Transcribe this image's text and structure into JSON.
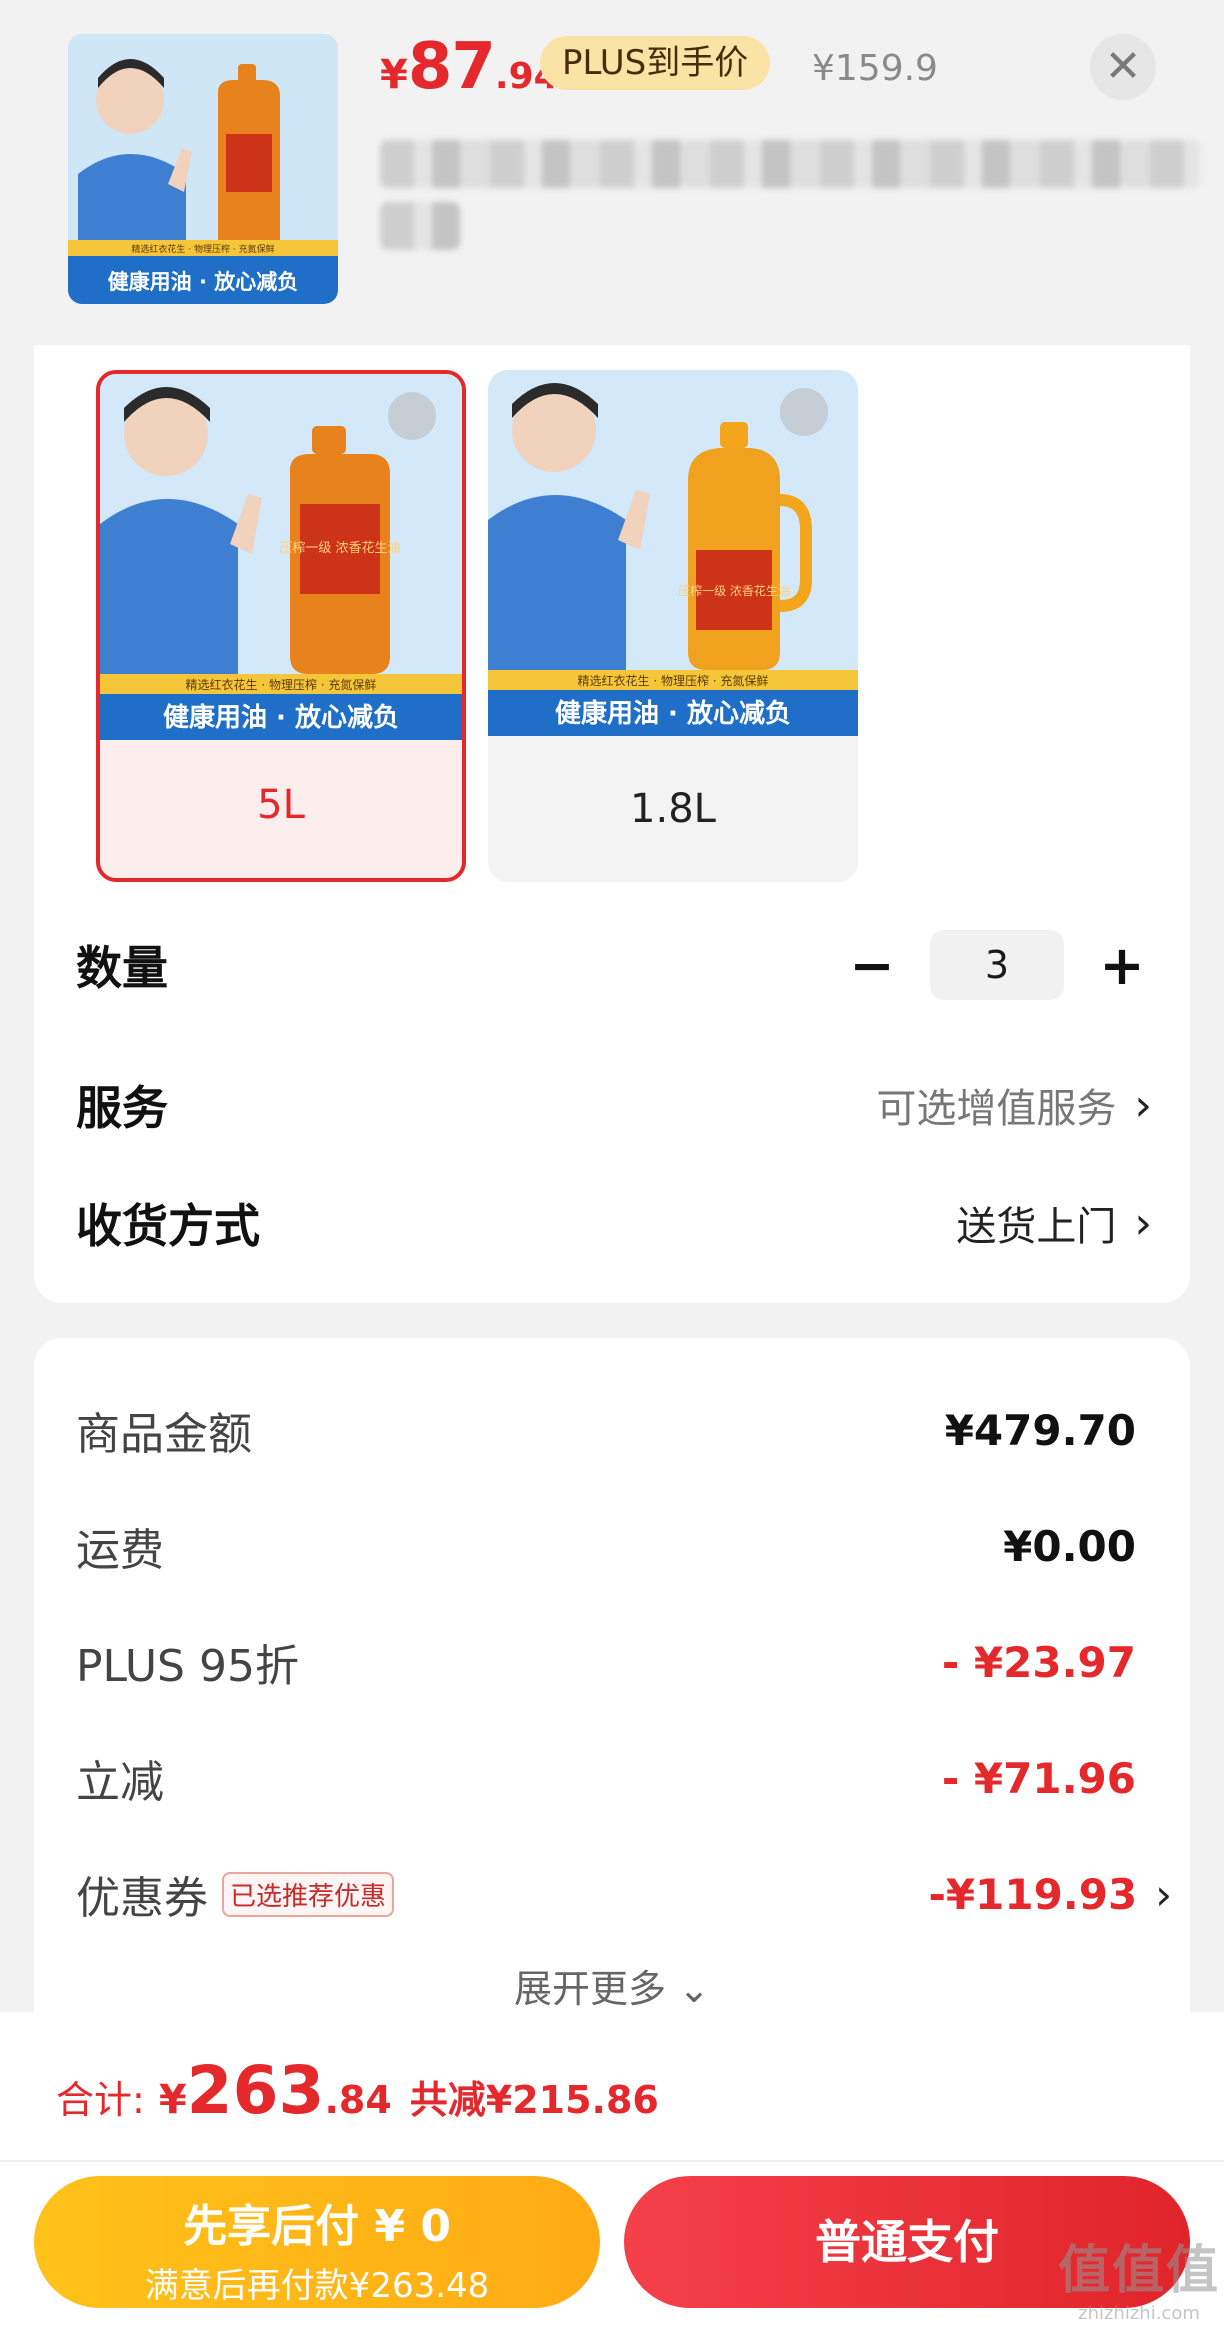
{
  "header": {
    "price": {
      "currency": "¥",
      "integer": "87",
      "decimal": ".94"
    },
    "plus_badge": "PLUS到手价",
    "original_price": "¥159.9",
    "close_icon": "close-icon",
    "thumb_banner": "健康用油 · 放心减负",
    "thumb_sub": "精选红衣花生 · 物理压榨 · 充氮保鲜"
  },
  "variants": [
    {
      "label": "5L",
      "banner": "健康用油 · 放心减负",
      "sub": "精选红衣花生 · 物理压榨 · 充氮保鲜",
      "bottle": "压榨一级 浓香花生油",
      "selected": true
    },
    {
      "label": "1.8L",
      "banner": "健康用油 · 放心减负",
      "sub": "精选红衣花生 · 物理压榨 · 充氮保鲜",
      "bottle": "压榨一级 浓香花生油",
      "selected": false
    }
  ],
  "options": {
    "quantity_label": "数量",
    "quantity_minus": "−",
    "quantity_value": "3",
    "quantity_plus": "+",
    "service_label": "服务",
    "service_value": "可选增值服务",
    "delivery_label": "收货方式",
    "delivery_value": "送货上门",
    "chevron": "›"
  },
  "fees": {
    "goods_label": "商品金额",
    "goods_value": "¥479.70",
    "shipping_label": "运费",
    "shipping_value": "¥0.00",
    "plus_label": "PLUS 95折",
    "plus_value": "- ¥23.97",
    "discount_label": "立减",
    "discount_value": "- ¥71.96",
    "coupon_label": "优惠券",
    "coupon_tag": "已选推荐优惠",
    "coupon_value": "-¥119.93",
    "expand_more": "展开更多 ⌄"
  },
  "total": {
    "label": "合计:",
    "currency": "¥",
    "integer": "263",
    "decimal": ".84",
    "saved": "共减¥215.86"
  },
  "pay": {
    "later_title": "先享后付 ¥ 0",
    "later_sub": "满意后再付款¥263.48",
    "normal": "普通支付"
  },
  "watermark": {
    "main": "值值值",
    "sub": "zhizhizhi.com"
  },
  "colors": {
    "accent_red": "#e4282b",
    "plus_gold": "#fbe3a6",
    "pay_later": "#ffb514"
  }
}
